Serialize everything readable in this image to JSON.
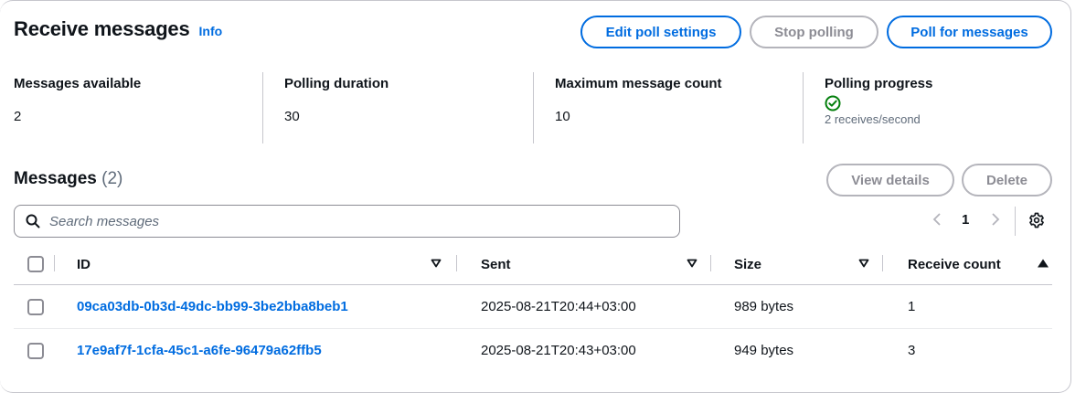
{
  "header": {
    "title": "Receive messages",
    "info_label": "Info",
    "buttons": {
      "edit_poll": "Edit poll settings",
      "stop_polling": "Stop polling",
      "poll_messages": "Poll for messages"
    }
  },
  "stats": [
    {
      "label": "Messages available",
      "value": "2"
    },
    {
      "label": "Polling duration",
      "value": "30"
    },
    {
      "label": "Maximum message count",
      "value": "10"
    },
    {
      "label": "Polling progress",
      "value": "2 receives/second",
      "icon": "check-circle-icon",
      "status_color": "#037f0c"
    }
  ],
  "messages": {
    "title": "Messages",
    "count": "(2)",
    "view_details": "View details",
    "delete": "Delete",
    "search_placeholder": "Search messages",
    "page": "1",
    "columns": [
      "ID",
      "Sent",
      "Size",
      "Receive count"
    ],
    "rows": [
      {
        "id": "09ca03db-0b3d-49dc-bb99-3be2bba8beb1",
        "sent": "2025-08-21T20:44+03:00",
        "size": "989 bytes",
        "receive_count": "1"
      },
      {
        "id": "17e9af7f-1cfa-45c1-a6fe-96479a62ffb5",
        "sent": "2025-08-21T20:43+03:00",
        "size": "949 bytes",
        "receive_count": "3"
      }
    ]
  },
  "colors": {
    "link": "#006ce0",
    "success": "#037f0c",
    "disabled": "#8c8c94"
  }
}
